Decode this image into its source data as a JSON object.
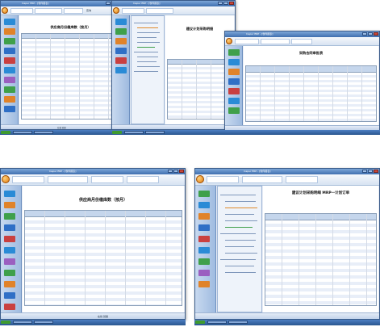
{
  "app": {
    "window_title": "Inspur ERP - [零件报表]",
    "taskbar_item": "Inspur ERP"
  },
  "screens": {
    "a": {
      "doc_title": "供应商月份缴库数（按月）"
    },
    "b": {
      "doc_title": "建议计划采购明细"
    },
    "c": {
      "doc_title": "采购合同审批表"
    },
    "d": {
      "doc_title": "供应商月份缴库数（按月）"
    },
    "e": {
      "doc_title": "建议计划采购明细 MRP一计划订单"
    }
  },
  "toolbar": {
    "search_label": "查询"
  },
  "statusbar": {
    "text": "在线  就绪"
  },
  "colors": {
    "accent": "#3f6fb0",
    "ribbon": "#d7e3f2",
    "sidebar": "#9fbbe0",
    "grid_header": "#c5d6ec"
  }
}
